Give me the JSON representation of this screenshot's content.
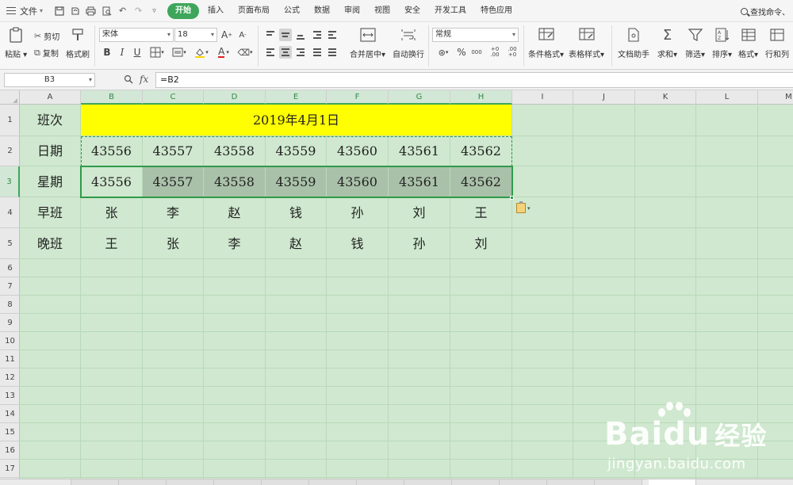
{
  "menubar": {
    "file_label": "文件",
    "tabs": [
      {
        "label": "开始",
        "active": true
      },
      {
        "label": "插入"
      },
      {
        "label": "页面布局"
      },
      {
        "label": "公式"
      },
      {
        "label": "数据"
      },
      {
        "label": "审阅"
      },
      {
        "label": "视图"
      },
      {
        "label": "安全"
      },
      {
        "label": "开发工具"
      },
      {
        "label": "特色应用"
      }
    ],
    "search_label": "查找命令、"
  },
  "ribbon": {
    "paste": "粘贴",
    "cut": "剪切",
    "copy": "复制",
    "format_painter": "格式刷",
    "font_name": "宋体",
    "font_size": "18",
    "merge_center": "合并居中",
    "wrap_text": "自动换行",
    "number_format": "常规",
    "conditional_format": "条件格式",
    "table_style": "表格样式",
    "doc_helper": "文档助手",
    "sum": "求和",
    "filter": "筛选",
    "sort": "排序",
    "format": "格式",
    "row_col": "行和列",
    "bold": "B",
    "italic": "I",
    "underline": "U",
    "font_color": "A",
    "percent": "%",
    "thousands": "000",
    "inc_decimal": "+0 .00",
    "dec_decimal": ".00 +0"
  },
  "formula_bar": {
    "cell_ref": "B3",
    "fx": "fx",
    "formula": "=B2"
  },
  "columns": [
    "A",
    "B",
    "C",
    "D",
    "E",
    "F",
    "G",
    "H",
    "I",
    "J",
    "K",
    "L",
    "M"
  ],
  "rows": [
    "1",
    "2",
    "3",
    "4",
    "5",
    "6",
    "7",
    "8",
    "9",
    "10",
    "11",
    "12",
    "13",
    "14",
    "15",
    "16",
    "17"
  ],
  "table": {
    "title": "2019年4月1日",
    "row_labels": [
      "班次",
      "日期",
      "星期",
      "早班",
      "晚班"
    ],
    "date_row": [
      "43556",
      "43557",
      "43558",
      "43559",
      "43560",
      "43561",
      "43562"
    ],
    "weekday_row": [
      "43556",
      "43557",
      "43558",
      "43559",
      "43560",
      "43561",
      "43562"
    ],
    "morning_shift": [
      "张",
      "李",
      "赵",
      "钱",
      "孙",
      "刘",
      "王"
    ],
    "evening_shift": [
      "王",
      "张",
      "李",
      "赵",
      "钱",
      "孙",
      "刘"
    ]
  },
  "watermark": {
    "brand": "Bai",
    "brand_du": "du",
    "brand_cn": "经验",
    "url": "jingyan.baidu.com"
  },
  "colors": {
    "accent": "#3ea65a",
    "title_fill": "#ffff00",
    "selected_fill": "#a9c1a9",
    "sheet_bg": "#cfe8cf"
  }
}
